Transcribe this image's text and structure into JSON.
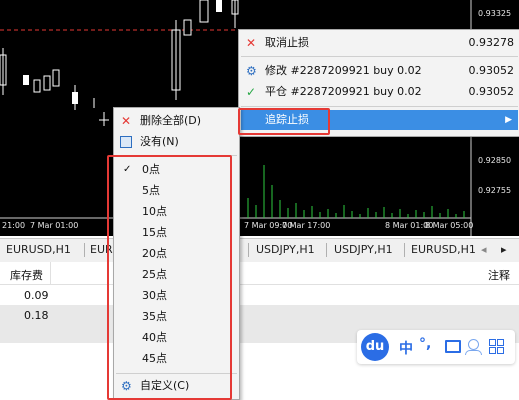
{
  "chart": {
    "price_ticks": [
      "0.93325",
      "0.92850",
      "0.92755"
    ],
    "time_ticks": [
      "21:00",
      "7 Mar 01:00",
      "7 Mar 09:00",
      "7 Mar 17:00",
      "8 Mar 01:00",
      "8 Mar 05:00"
    ],
    "right_value": "0.93278"
  },
  "tabs": [
    "EURUSD,H1",
    "EUR",
    "USDJPY,H1",
    "USDJPY,H1",
    "EURUSD,H1"
  ],
  "panel": {
    "col_swap": "库存费",
    "col_comment": "注释",
    "rows": [
      "0.09",
      "0.18"
    ]
  },
  "order_menu": {
    "items": [
      {
        "label": "取消止损",
        "value": "0.93278",
        "icon": "close-icon"
      },
      {
        "label": "修改 #2287209921 buy 0.02",
        "value": "0.93052",
        "icon": "gear-icon"
      },
      {
        "label": "平仓 #2287209921 buy 0.02",
        "value": "0.93052",
        "icon": "check-icon"
      },
      {
        "label": "追踪止损",
        "icon": "chevron-right-icon"
      }
    ]
  },
  "trailing_menu": {
    "delete_all": "删除全部(D)",
    "none": "没有(N)",
    "points": [
      "0点",
      "5点",
      "10点",
      "15点",
      "20点",
      "25点",
      "30点",
      "35点",
      "40点",
      "45点"
    ],
    "custom": "自定义(C)"
  },
  "toolbar": {
    "logo": "du",
    "zh": "中",
    "punct": "°,"
  }
}
